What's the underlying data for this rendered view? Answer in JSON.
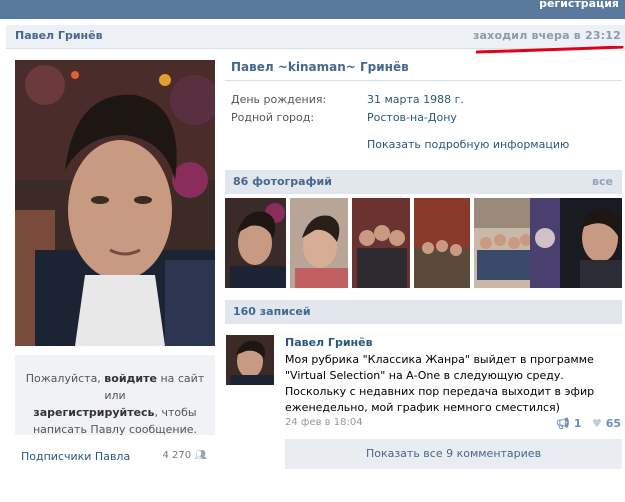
{
  "topbar": {
    "register_label": "регистрация"
  },
  "header": {
    "name": "Павел Гринёв",
    "last_seen": "заходил вчера в 23:12"
  },
  "profile": {
    "full_name": "Павел ~kinaman~ Гринёв",
    "fields": [
      {
        "label": "День рождения:",
        "value": "31 марта 1988 г."
      },
      {
        "label": "Родной город:",
        "value": "Ростов-на-Дону"
      }
    ],
    "more_info_label": "Показать подробную информацию"
  },
  "login_prompt": {
    "text_1": "Пожалуйста, ",
    "login_link": "войдите",
    "text_2": " на сайт или",
    "register_link": "зарегистрируйтесь",
    "text_3": ", чтобы",
    "text_4": "написать Павлу сообщение."
  },
  "followers": {
    "label": "Подписчики Павла",
    "count": "4 270"
  },
  "photos": {
    "title": "86 фотографий",
    "all_label": "все"
  },
  "wall": {
    "title": "160 записей",
    "post": {
      "author": "Павел Гринёв",
      "text": "Моя рубрика \"Классика Жанра\" выйдет в программе \"Virtual Selection\" на A-One в следующую среду. Поскольку с недавних пор передача выходит в эфир еженедельно, мой график немного сместился)",
      "date": "24 фев в 18:04",
      "reposts": "1",
      "likes": "65",
      "comments_button": "Показать все 9 комментариев"
    }
  },
  "colors": {
    "accent": "#45688e",
    "header_bg": "#59799d",
    "highlight": "#e2001a"
  }
}
